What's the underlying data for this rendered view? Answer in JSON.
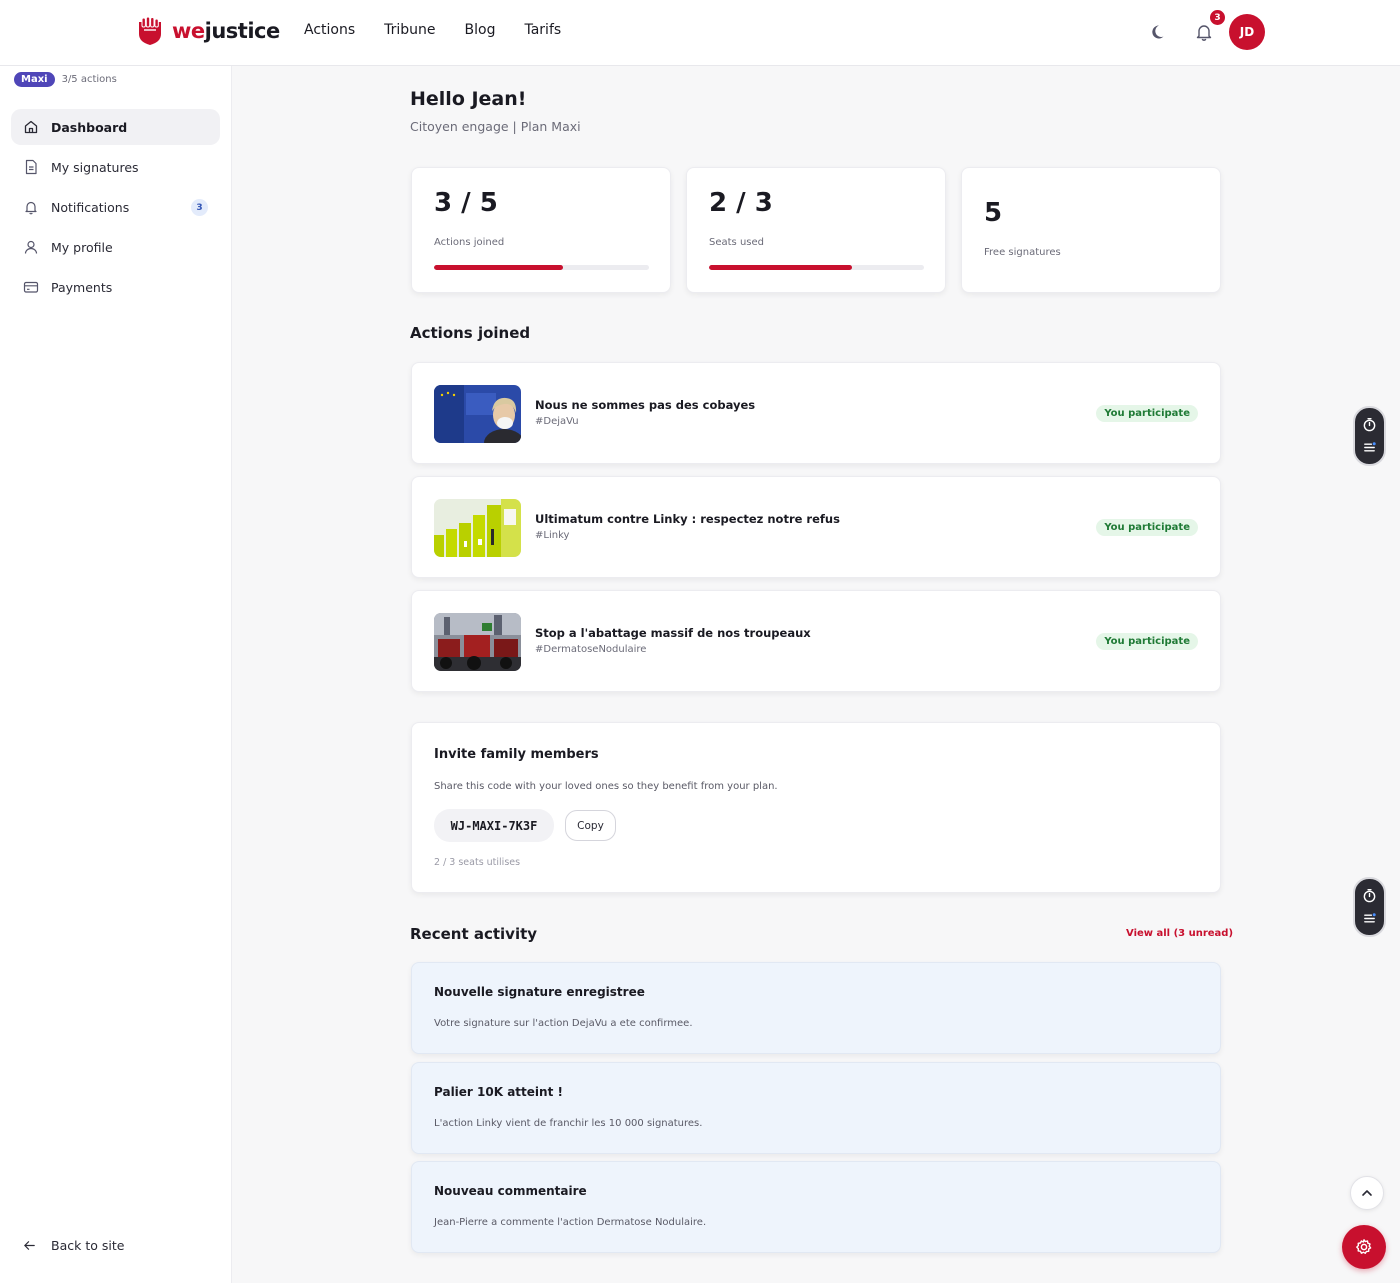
{
  "brand": {
    "prefix": "we",
    "suffix": "justice"
  },
  "nav": [
    "Actions",
    "Tribune",
    "Blog",
    "Tarifs"
  ],
  "header": {
    "notification_count": "3",
    "user_initials": "JD"
  },
  "sidebar": {
    "plan_badge": "Maxi",
    "plan_count": "3/5 actions",
    "items": [
      {
        "label": "Dashboard",
        "icon": "home-icon",
        "active": true
      },
      {
        "label": "My signatures",
        "icon": "document-icon"
      },
      {
        "label": "Notifications",
        "icon": "bell-icon",
        "badge": "3"
      },
      {
        "label": "My profile",
        "icon": "user-icon"
      },
      {
        "label": "Payments",
        "icon": "card-icon"
      }
    ],
    "back_label": "Back to site"
  },
  "greeting": {
    "title": "Hello Jean!",
    "subtitle": "Citoyen engage | Plan Maxi"
  },
  "stats": [
    {
      "value": "3 / 5",
      "label": "Actions joined",
      "progress": 0.6
    },
    {
      "value": "2 / 3",
      "label": "Seats used",
      "progress": 0.667
    },
    {
      "value": "5",
      "label": "Free signatures"
    }
  ],
  "actions_section": {
    "title": "Actions joined",
    "items": [
      {
        "title": "Nous ne sommes pas des cobayes",
        "tag": "#DejaVu",
        "status": "You participate"
      },
      {
        "title": "Ultimatum contre Linky : respectez notre refus",
        "tag": "#Linky",
        "status": "You participate"
      },
      {
        "title": "Stop a l'abattage massif de nos troupeaux",
        "tag": "#DermatoseNodulaire",
        "status": "You participate"
      }
    ]
  },
  "invite": {
    "title": "Invite family members",
    "description": "Share this code with your loved ones so they benefit from your plan.",
    "code": "WJ-MAXI-7K3F",
    "copy_label": "Copy",
    "seats_note": "2 / 3 seats utilises"
  },
  "activity": {
    "title": "Recent activity",
    "view_all": "View all (3 unread)",
    "items": [
      {
        "title": "Nouvelle signature enregistree",
        "body": "Votre signature sur l'action DejaVu a ete confirmee."
      },
      {
        "title": "Palier 10K atteint !",
        "body": "L'action Linky vient de franchir les 10 000 signatures."
      },
      {
        "title": "Nouveau commentaire",
        "body": "Jean-Pierre a commente l'action Dermatose Nodulaire."
      }
    ]
  },
  "colors": {
    "brand_red": "#c8102e",
    "plan_purple": "#4f46b8",
    "participate_green": "#1f7a35"
  }
}
